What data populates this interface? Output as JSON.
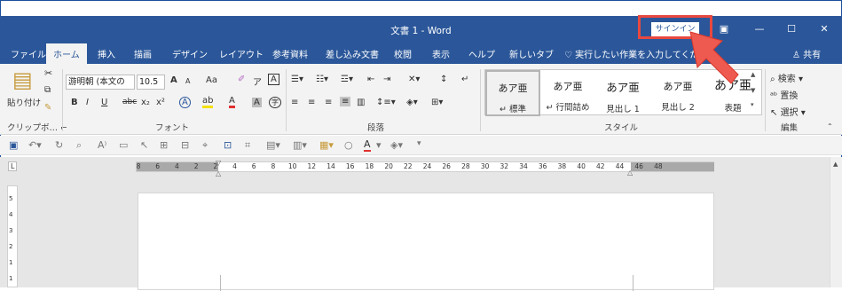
{
  "titlebar": {
    "title": "文書 1 - Word",
    "signin": "サインイン",
    "ribbon_opts_icon": "ribbon-display-options-icon",
    "minimize": "—",
    "maximize": "☐",
    "close": "✕"
  },
  "tabs": [
    {
      "label": "ファイル"
    },
    {
      "label": "ホーム"
    },
    {
      "label": "挿入"
    },
    {
      "label": "描画"
    },
    {
      "label": "デザイン"
    },
    {
      "label": "レイアウト"
    },
    {
      "label": "参考資料"
    },
    {
      "label": "差し込み文書"
    },
    {
      "label": "校閲"
    },
    {
      "label": "表示"
    },
    {
      "label": "ヘルプ"
    },
    {
      "label": "新しいタブ"
    }
  ],
  "tellme": "実行したい作業を入力してください",
  "share": "共有",
  "clipboard": {
    "paste": "貼り付け",
    "label": "クリップボ… ⌐"
  },
  "font": {
    "name": "游明朝 (本文の",
    "size": "10.5",
    "label": "フォント",
    "bold": "B",
    "italic": "I",
    "underline": "U",
    "strike": "abc",
    "sub": "x₂",
    "sup": "x²",
    "grow": "A",
    "shrink": "A",
    "case": "Aa",
    "color": "A",
    "box": "A"
  },
  "paragraph": {
    "label": "段落"
  },
  "styles": {
    "label": "スタイル",
    "items": [
      {
        "preview": "あア亜",
        "name": "↵ 標準"
      },
      {
        "preview": "あア亜",
        "name": "↵ 行間詰め"
      },
      {
        "preview": "あア亜",
        "name": "見出し 1"
      },
      {
        "preview": "あア亜",
        "name": "見出し 2"
      },
      {
        "preview": "あア亜",
        "name": "表題"
      }
    ]
  },
  "editing": {
    "label": "編集",
    "find": "検索",
    "replace": "置換",
    "select": "選択"
  },
  "ruler": {
    "ticks": [
      "8",
      "6",
      "4",
      "2",
      "2",
      "4",
      "6",
      "8",
      "10",
      "12",
      "14",
      "16",
      "18",
      "20",
      "22",
      "24",
      "26",
      "28",
      "30",
      "32",
      "34",
      "36",
      "38",
      "40",
      "42",
      "44",
      "46",
      "48"
    ]
  },
  "vruler": [
    "5",
    "4",
    "3",
    "2",
    "1",
    "1"
  ]
}
